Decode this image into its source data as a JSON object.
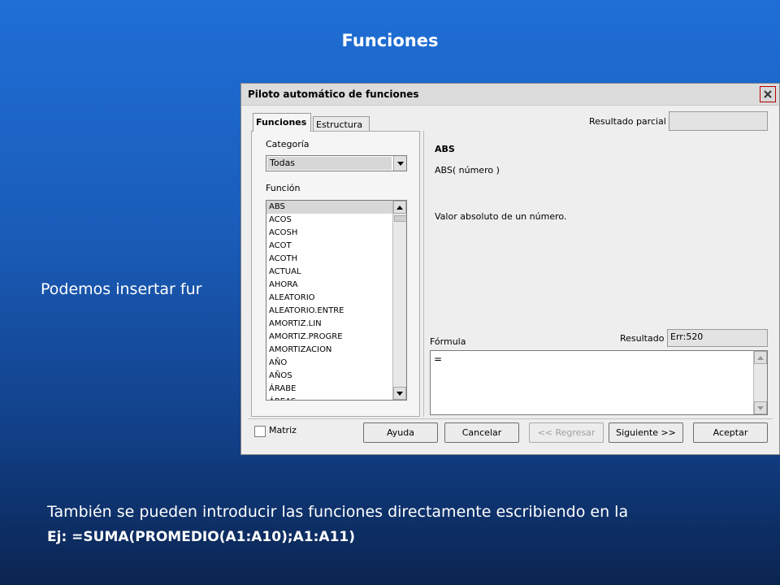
{
  "slide": {
    "title": "Funciones",
    "intro": "Podemos insertar fur",
    "bottom_text": "También se pueden introducir las funciones directamente escribiendo en la",
    "example": "Ej:  =SUMA(PROMEDIO(A1:A10);A1:A11)"
  },
  "dialog": {
    "title": "Piloto automático de funciones",
    "tabs": [
      "Funciones",
      "Estructura"
    ],
    "category_label": "Categoría",
    "category_value": "Todas",
    "function_label": "Función",
    "functions": [
      "ABS",
      "ACOS",
      "ACOSH",
      "ACOT",
      "ACOTH",
      "ACTUAL",
      "AHORA",
      "ALEATORIO",
      "ALEATORIO.ENTRE",
      "AMORTIZ.LIN",
      "AMORTIZ.PROGRE",
      "AMORTIZACION",
      "AÑO",
      "AÑOS",
      "ÁRABE",
      "ÁREAS"
    ],
    "selected_function": "ABS",
    "partial_result_label": "Resultado parcial",
    "partial_result_value": "",
    "fn_name": "ABS",
    "fn_syntax": "ABS( número )",
    "fn_description": "Valor absoluto de un número.",
    "formula_label": "Fórmula",
    "result_label": "Resultado",
    "result_value": "Err:520",
    "formula_value": "=",
    "matrix_label": "Matriz",
    "buttons": {
      "help": "Ayuda",
      "cancel": "Cancelar",
      "back": "<< Regresar",
      "next": "Siguiente >>",
      "ok": "Aceptar"
    }
  },
  "colors": {
    "background_top": "#1f6fd6",
    "background_bottom": "#0b2450",
    "dialog_bg": "#eeeeee",
    "close_border": "#bb0000"
  },
  "icons": {
    "close": "close-icon",
    "dropdown": "chevron-down-icon",
    "scroll_up": "chevron-up-icon",
    "scroll_down": "chevron-down-icon"
  }
}
